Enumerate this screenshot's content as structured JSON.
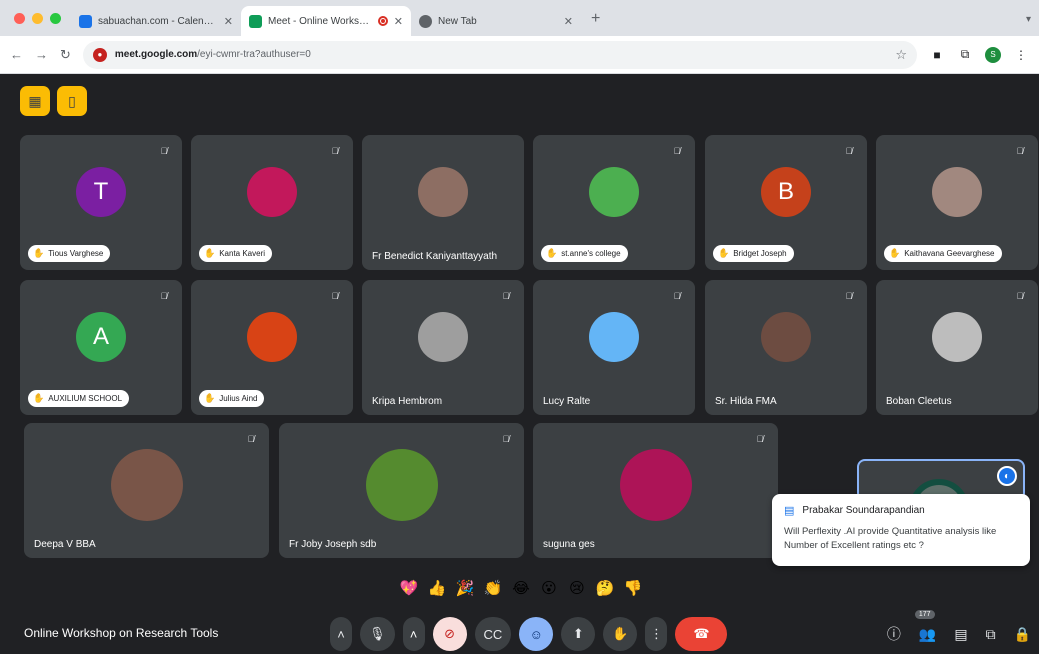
{
  "browser": {
    "tabs": [
      {
        "title": "sabuachan.com - Calendar -",
        "favicon_color": "#1a73e8",
        "active": false
      },
      {
        "title": "Meet - Online Workshop o",
        "favicon_color": "#0f9d58",
        "active": true
      },
      {
        "title": "New Tab",
        "favicon_color": "#5f6368",
        "active": false
      }
    ],
    "url_host": "meet.google.com",
    "url_path": "/eyi-cwmr-tra?authuser=0",
    "profile_initial": "S"
  },
  "meet": {
    "meeting_title": "Online Workshop on Research Tools",
    "participant_count": "177",
    "participants": [
      {
        "name": "Tious Varghese",
        "initial": "T",
        "color": "#7b1fa2",
        "chip": true
      },
      {
        "name": "Kanta Kaveri",
        "initial": "",
        "color": "#c2185b",
        "chip": true
      },
      {
        "name": "Fr Benedict Kaniyanttayyath",
        "initial": "",
        "color": "#8d6e63",
        "chip": false
      },
      {
        "name": "st.anne's college",
        "initial": "",
        "color": "#4caf50",
        "chip": true
      },
      {
        "name": "Bridget Joseph",
        "initial": "B",
        "color": "#c5411b",
        "chip": true
      },
      {
        "name": "Kaithavana Geevarghese",
        "initial": "",
        "color": "#a1887f",
        "chip": true
      },
      {
        "name": "AUXILIUM SCHOOL",
        "initial": "A",
        "color": "#34a853",
        "chip": true
      },
      {
        "name": "Julius Aind",
        "initial": "",
        "color": "#d84315",
        "chip": true
      },
      {
        "name": "Kripa Hembrom",
        "initial": "",
        "color": "#9e9e9e",
        "chip": false
      },
      {
        "name": "Lucy Ralte",
        "initial": "",
        "color": "#64b5f6",
        "chip": false
      },
      {
        "name": "Sr. Hilda FMA",
        "initial": "",
        "color": "#6d4c41",
        "chip": false
      },
      {
        "name": "Boban Cleetus",
        "initial": "",
        "color": "#bdbdbd",
        "chip": false
      },
      {
        "name": "Deepa V BBA",
        "initial": "",
        "color": "#795548",
        "chip": false
      },
      {
        "name": "Fr Joby Joseph sdb",
        "initial": "",
        "color": "#558b2f",
        "chip": false
      },
      {
        "name": "suguna ges",
        "initial": "",
        "color": "#ad1457",
        "chip": false
      }
    ],
    "notification": {
      "sender": "Prabakar Soundarapandian",
      "message": "Will Perflexity .AI provide Quantitative analysis like Number of Excellent ratings etc ?"
    },
    "reactions": [
      "💖",
      "👍",
      "🎉",
      "👏",
      "😂",
      "😮",
      "😢",
      "🤔",
      "👎"
    ]
  }
}
